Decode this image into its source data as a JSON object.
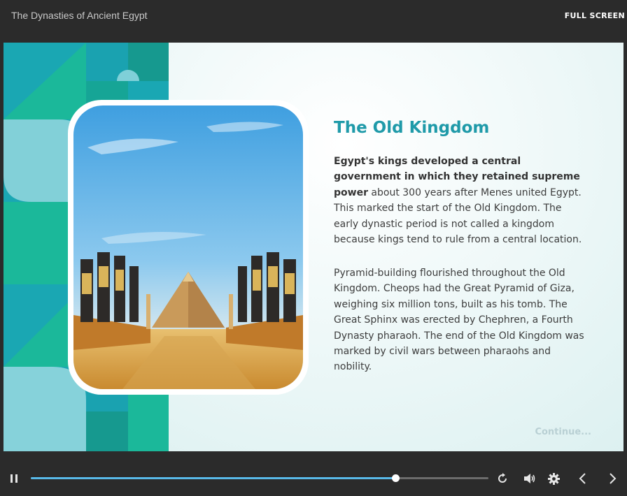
{
  "header": {
    "course_title": "The Dynasties of Ancient Egypt",
    "fullscreen_label": "FULL SCREEN"
  },
  "slide": {
    "heading": "The Old Kingdom",
    "paragraph1_bold": "Egypt's kings developed a central government in which they retained supreme power",
    "paragraph1_rest": " about 300 years after Menes united Egypt. This marked the start of the Old Kingdom. The early dynastic period is not called a kingdom because kings tend to rule from a central location.",
    "paragraph2": "Pyramid-building flourished throughout the Old Kingdom. Cheops had the Great Pyramid of Giza, weighing six million tons, built as his tomb. The Great Sphinx was erected by Chephren, a Fourth Dynasty pharaoh. The end of the Old Kingdom was marked by civil wars between pharaohs and nobility.",
    "continue_label": "Continue...",
    "image": "Illustration of a pyramid at the end of an avenue lined with Anubis statues under a blue sky"
  },
  "player": {
    "progress": 0.796,
    "icons": [
      "pause-icon",
      "replay-icon",
      "volume-icon",
      "settings-icon",
      "previous-icon",
      "next-icon"
    ]
  },
  "colors": {
    "accent": "#1f9aa9",
    "progress": "#58b9e8",
    "bar": "#2b2b2b"
  }
}
